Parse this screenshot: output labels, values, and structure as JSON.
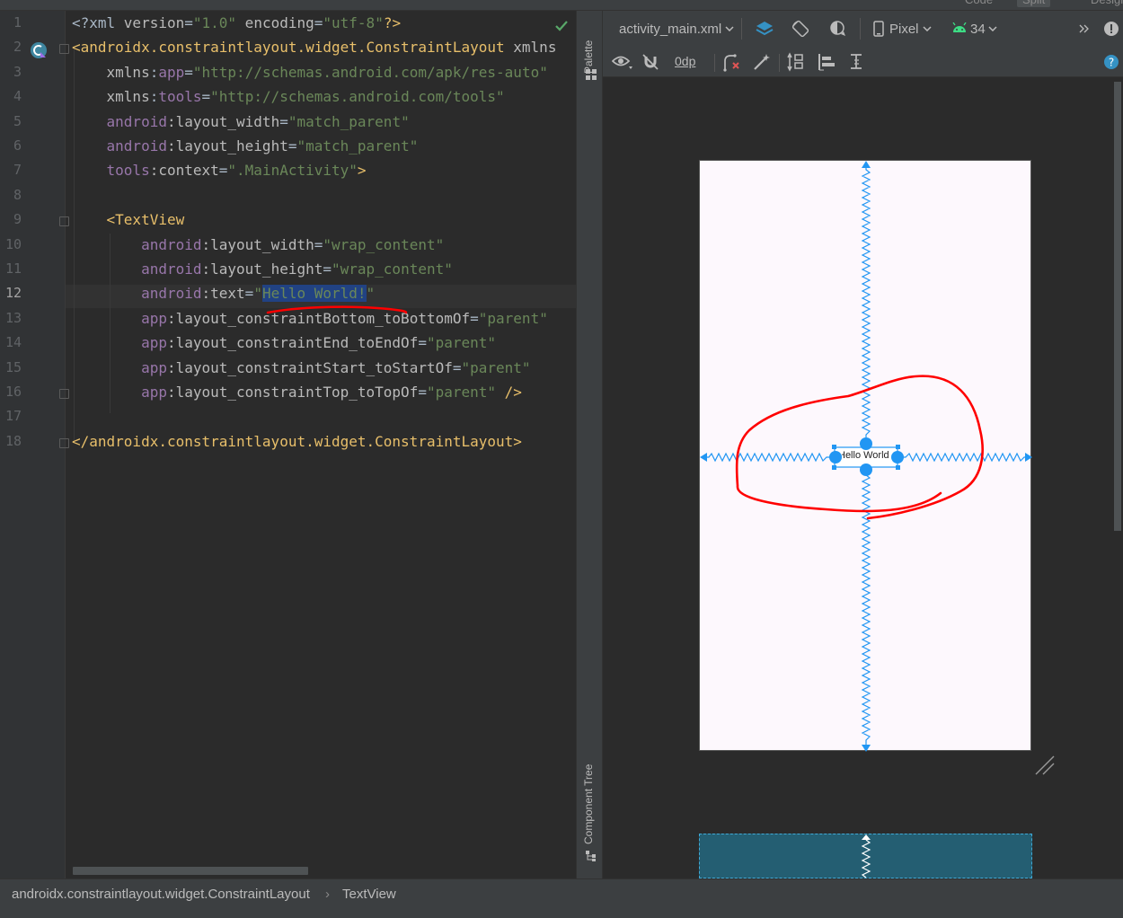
{
  "editor": {
    "line_numbers": [
      "1",
      "2",
      "3",
      "4",
      "5",
      "6",
      "7",
      "8",
      "9",
      "10",
      "11",
      "12",
      "13",
      "14",
      "15",
      "16",
      "17",
      "18"
    ],
    "lines": [
      [
        {
          "t": "<?xml ",
          "c": "c-punc"
        },
        {
          "t": "version",
          "c": "c-attr"
        },
        {
          "t": "=",
          "c": "c-punc"
        },
        {
          "t": "\"1.0\"",
          "c": "c-str"
        },
        {
          "t": " encoding",
          "c": "c-attr"
        },
        {
          "t": "=",
          "c": "c-punc"
        },
        {
          "t": "\"utf-8\"",
          "c": "c-str"
        },
        {
          "t": "?>",
          "c": "c-tag"
        }
      ],
      [
        {
          "t": "<androidx.constraintlayout.widget.ConstraintLayout ",
          "c": "c-tag"
        },
        {
          "t": "xmlns",
          "c": "c-attr"
        }
      ],
      [
        {
          "t": "    "
        },
        {
          "t": "xmlns",
          "c": "c-attr"
        },
        {
          "t": ":",
          "c": "c-punc"
        },
        {
          "t": "app",
          "c": "c-ns"
        },
        {
          "t": "=",
          "c": "c-punc"
        },
        {
          "t": "\"http://schemas.android.com/apk/res-auto\"",
          "c": "c-str"
        }
      ],
      [
        {
          "t": "    "
        },
        {
          "t": "xmlns",
          "c": "c-attr"
        },
        {
          "t": ":",
          "c": "c-punc"
        },
        {
          "t": "tools",
          "c": "c-ns"
        },
        {
          "t": "=",
          "c": "c-punc"
        },
        {
          "t": "\"http://schemas.android.com/tools\"",
          "c": "c-str"
        }
      ],
      [
        {
          "t": "    "
        },
        {
          "t": "android",
          "c": "c-ns"
        },
        {
          "t": ":layout_width",
          "c": "c-attr"
        },
        {
          "t": "=",
          "c": "c-punc"
        },
        {
          "t": "\"match_parent\"",
          "c": "c-str"
        }
      ],
      [
        {
          "t": "    "
        },
        {
          "t": "android",
          "c": "c-ns"
        },
        {
          "t": ":layout_height",
          "c": "c-attr"
        },
        {
          "t": "=",
          "c": "c-punc"
        },
        {
          "t": "\"match_parent\"",
          "c": "c-str"
        }
      ],
      [
        {
          "t": "    "
        },
        {
          "t": "tools",
          "c": "c-ns"
        },
        {
          "t": ":context",
          "c": "c-attr"
        },
        {
          "t": "=",
          "c": "c-punc"
        },
        {
          "t": "\".MainActivity\"",
          "c": "c-str"
        },
        {
          "t": ">",
          "c": "c-tag"
        }
      ],
      [],
      [
        {
          "t": "    "
        },
        {
          "t": "<TextView",
          "c": "c-tag"
        }
      ],
      [
        {
          "t": "        "
        },
        {
          "t": "android",
          "c": "c-ns"
        },
        {
          "t": ":layout_width",
          "c": "c-attr"
        },
        {
          "t": "=",
          "c": "c-punc"
        },
        {
          "t": "\"wrap_content\"",
          "c": "c-str"
        }
      ],
      [
        {
          "t": "        "
        },
        {
          "t": "android",
          "c": "c-ns"
        },
        {
          "t": ":layout_height",
          "c": "c-attr"
        },
        {
          "t": "=",
          "c": "c-punc"
        },
        {
          "t": "\"wrap_content\"",
          "c": "c-str"
        }
      ],
      [
        {
          "t": "        "
        },
        {
          "t": "android",
          "c": "c-ns"
        },
        {
          "t": ":text",
          "c": "c-attr"
        },
        {
          "t": "=",
          "c": "c-punc"
        },
        {
          "t": "\"",
          "c": "c-str"
        },
        {
          "t": "Hello World!",
          "c": "c-str c-sel"
        },
        {
          "t": "\"",
          "c": "c-str"
        }
      ],
      [
        {
          "t": "        "
        },
        {
          "t": "app",
          "c": "c-ns"
        },
        {
          "t": ":layout_constraintBottom_toBottomOf",
          "c": "c-attr"
        },
        {
          "t": "=",
          "c": "c-punc"
        },
        {
          "t": "\"parent\"",
          "c": "c-str"
        }
      ],
      [
        {
          "t": "        "
        },
        {
          "t": "app",
          "c": "c-ns"
        },
        {
          "t": ":layout_constraintEnd_toEndOf",
          "c": "c-attr"
        },
        {
          "t": "=",
          "c": "c-punc"
        },
        {
          "t": "\"parent\"",
          "c": "c-str"
        }
      ],
      [
        {
          "t": "        "
        },
        {
          "t": "app",
          "c": "c-ns"
        },
        {
          "t": ":layout_constraintStart_toStartOf",
          "c": "c-attr"
        },
        {
          "t": "=",
          "c": "c-punc"
        },
        {
          "t": "\"parent\"",
          "c": "c-str"
        }
      ],
      [
        {
          "t": "        "
        },
        {
          "t": "app",
          "c": "c-ns"
        },
        {
          "t": ":layout_constraintTop_toTopOf",
          "c": "c-attr"
        },
        {
          "t": "=",
          "c": "c-punc"
        },
        {
          "t": "\"parent\"",
          "c": "c-str"
        },
        {
          "t": " />",
          "c": "c-tag"
        }
      ],
      [],
      [
        {
          "t": "</androidx.constraintlayout.widget.ConstraintLayout>",
          "c": "c-tag"
        }
      ]
    ]
  },
  "view_tabs": {
    "code": "Code",
    "split": "Split",
    "design": "Design"
  },
  "side_strip": {
    "palette": "Palette",
    "component_tree": "Component Tree"
  },
  "toolbar": {
    "file_name": "activity_main.xml",
    "device": "Pixel",
    "api_level": "34",
    "margin": "0dp"
  },
  "preview": {
    "textview_text": "Hello World"
  },
  "breadcrumb": [
    "androidx.constraintlayout.widget.ConstraintLayout",
    "TextView"
  ],
  "colors": {
    "accent": "#2196f3",
    "annotation": "#ff0000",
    "selection": "#214283"
  }
}
